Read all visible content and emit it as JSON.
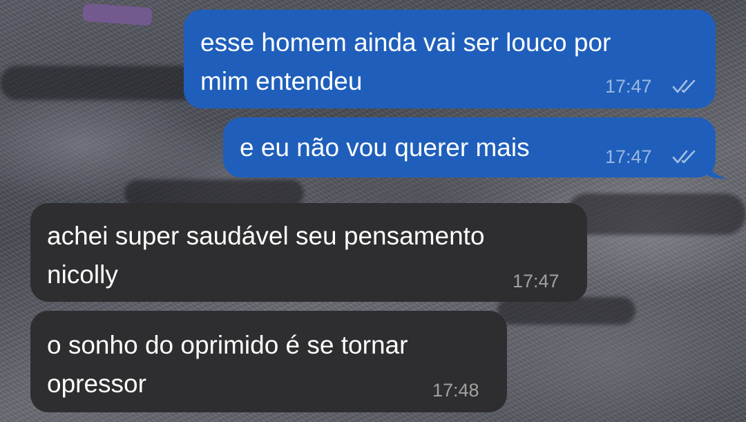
{
  "chat": {
    "messages": [
      {
        "direction": "outgoing",
        "text": "esse homem ainda vai ser louco por\nmim entendeu",
        "time": "17:47",
        "status": "read"
      },
      {
        "direction": "outgoing",
        "text": "e eu não vou querer mais",
        "time": "17:47",
        "status": "read"
      },
      {
        "direction": "incoming",
        "text": "achei super saudável seu pensamento\nnicolly",
        "time": "17:47"
      },
      {
        "direction": "incoming",
        "text": "o sonho do oprimido é se tornar\nopressor",
        "time": "17:48"
      }
    ]
  },
  "colors": {
    "outgoing_bubble": "#1f5fbb",
    "incoming_bubble": "#2e2e30",
    "text": "#ffffff"
  },
  "icons": {
    "read_receipt": "double-check-icon"
  }
}
